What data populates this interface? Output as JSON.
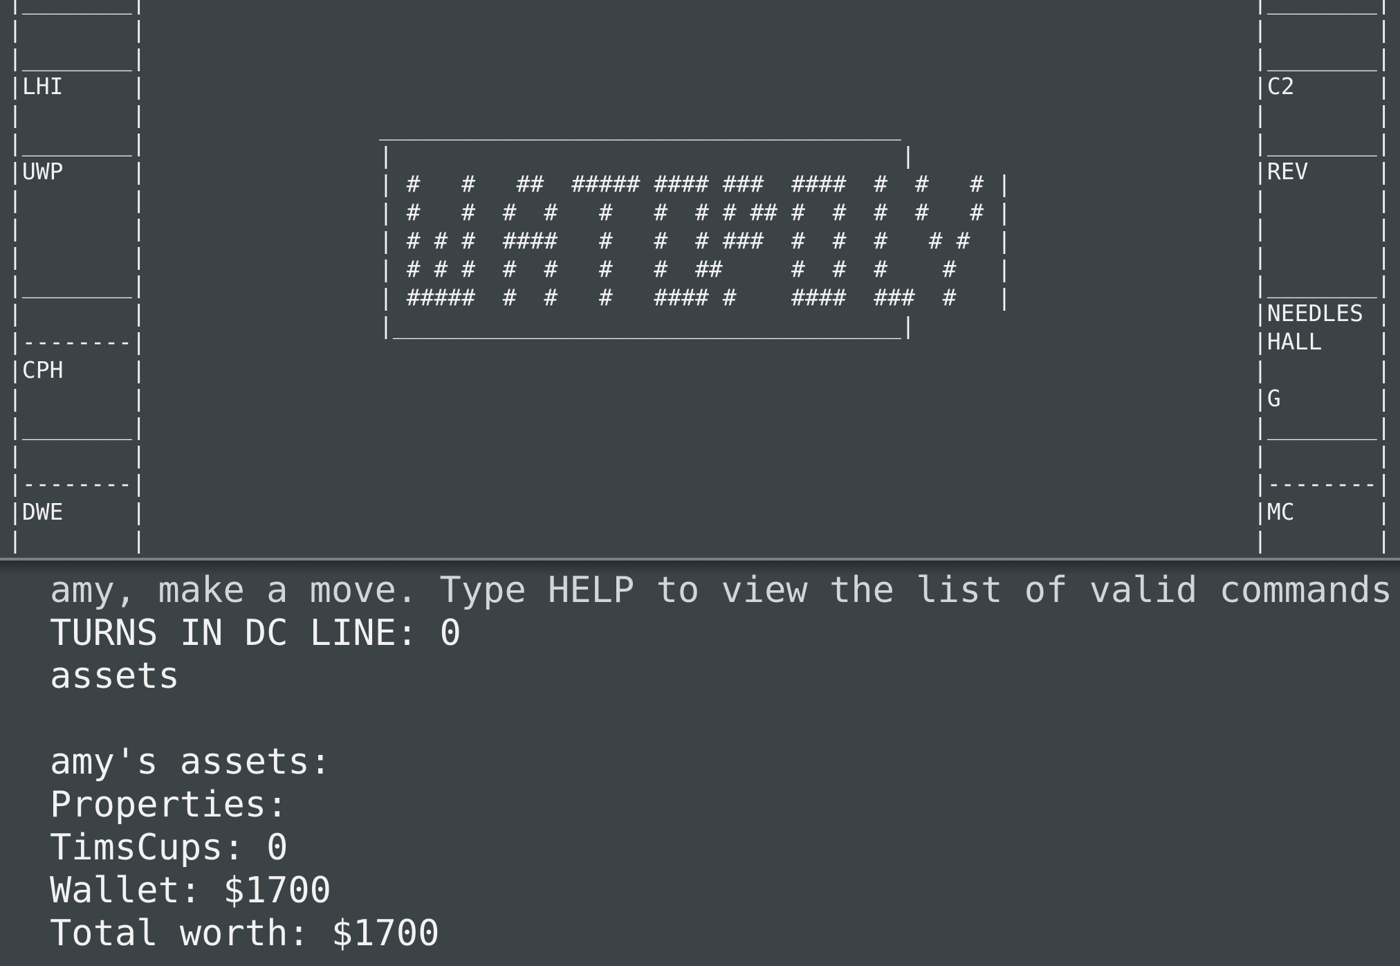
{
  "board": {
    "left_column": "|________|\n|        |\n|________|\n|LHI     |\n|        |\n|________|\n|UWP     |\n|        |\n|        |\n|        |\n|________|\n|        |\n|--------|\n|CPH     |\n|        |\n|________|\n|        |\n|--------|\n|DWE     |\n|        |",
    "right_column": "|________|\n|        |\n|________|\n|C2      |\n|        |\n|________|\n|REV     |\n|        |\n|        |\n|        |\n|________|\n|NEEDLES |\n|HALL    |\n|        |\n|G       |\n|________|\n|        |\n|--------|\n|MC      |\n|        |",
    "logo": "______________________________________\n|                                     |\n| #   #   ##  ##### #### ###  ####  #  #   # |\n| #   #  #  #   #   #  # # ## #  #  #  #   # |\n| # # #  ####   #   #  # ###  #  #  #   # #  |\n| # # #  #  #   #   #  ##     #  #  #    #   |\n| #####  #  #   #   #### #    ####  ###  #   |\n|_____________________________________|"
  },
  "console": {
    "lines": [
      "amy, make a move. Type HELP to view the list of valid commands!",
      "TURNS IN DC LINE: 0",
      "assets",
      "",
      "amy's assets:",
      "Properties:",
      "TimsCups: 0",
      "Wallet: $1700",
      "Total worth: $1700"
    ]
  },
  "colors": {
    "background": "#3c4347",
    "text": "#f2f2f2",
    "divider": "#7a7f82"
  }
}
